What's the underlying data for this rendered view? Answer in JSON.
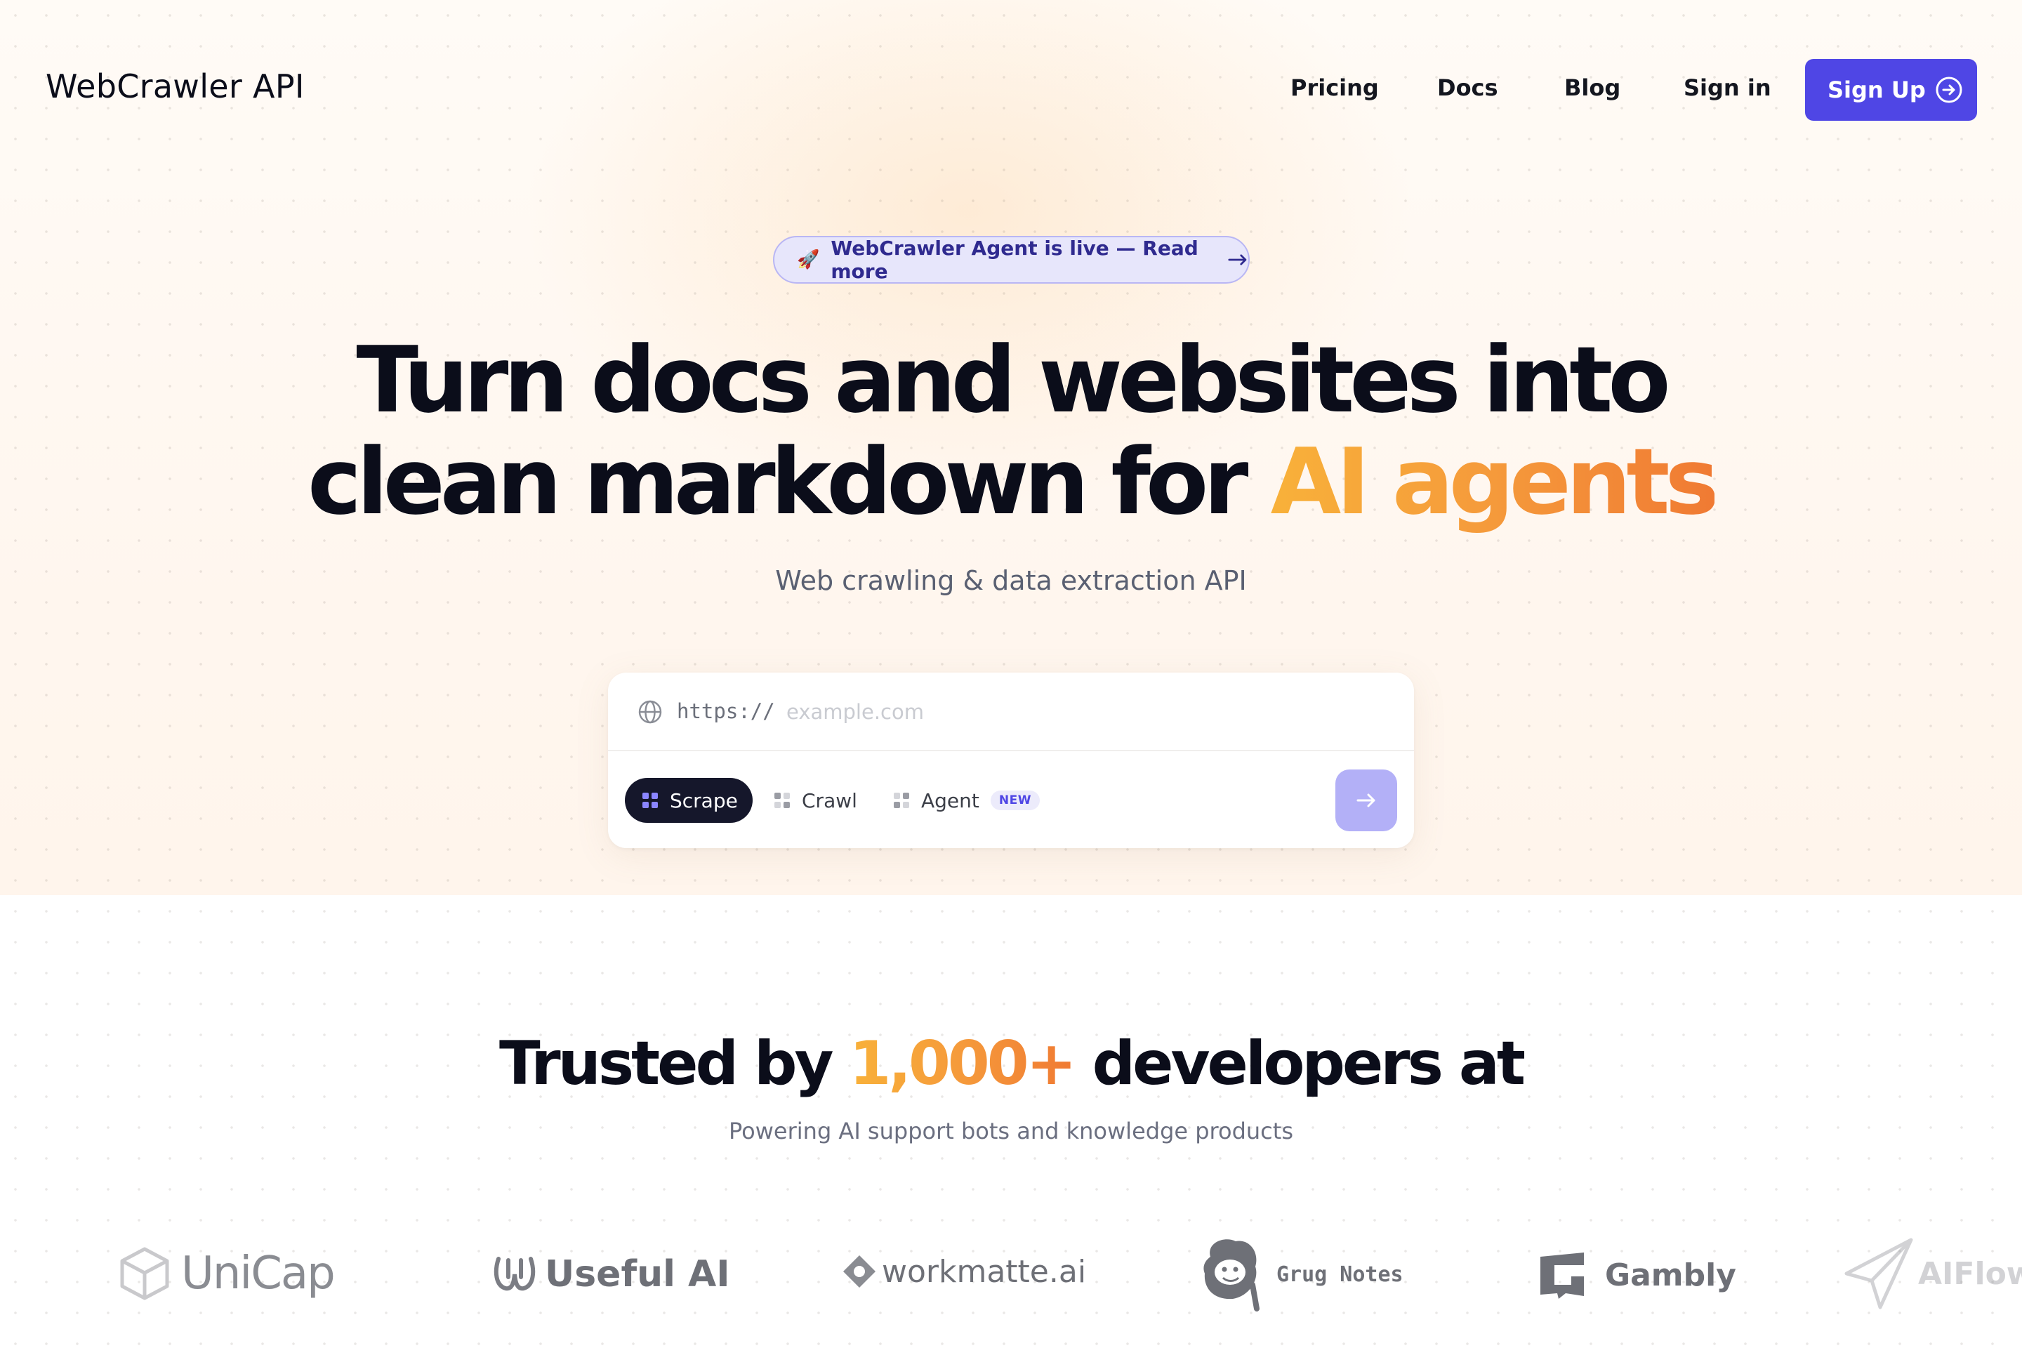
{
  "nav": {
    "brand": "WebCrawler API",
    "links": [
      "Pricing",
      "Docs",
      "Blog",
      "Sign in"
    ],
    "cta": "Sign Up"
  },
  "announcement": {
    "emoji": "🚀",
    "text": "WebCrawler Agent is live — Read more"
  },
  "hero": {
    "line1": "Turn docs and websites into",
    "line2_prefix": "clean markdown for ",
    "line2_accent": "AI agents",
    "subtitle": "Web crawling & data extraction API"
  },
  "url_box": {
    "protocol": "https://",
    "placeholder": "example.com",
    "modes": [
      {
        "label": "Scrape",
        "active": true
      },
      {
        "label": "Crawl",
        "active": false
      },
      {
        "label": "Agent",
        "active": false,
        "badge": "NEW"
      }
    ]
  },
  "trusted": {
    "prefix": "Trusted by ",
    "accent": "1,000+",
    "suffix": " developers at",
    "subtitle": "Powering AI support bots and knowledge products"
  },
  "customers": [
    "UniCap",
    "Useful AI",
    "workmatte.ai",
    "Grug Notes",
    "Gambly",
    "AIFlow"
  ],
  "colors": {
    "primary": "#4f46e5",
    "accent_start": "#f8b13a",
    "accent_end": "#f07a33",
    "dark": "#0b0d1a"
  }
}
